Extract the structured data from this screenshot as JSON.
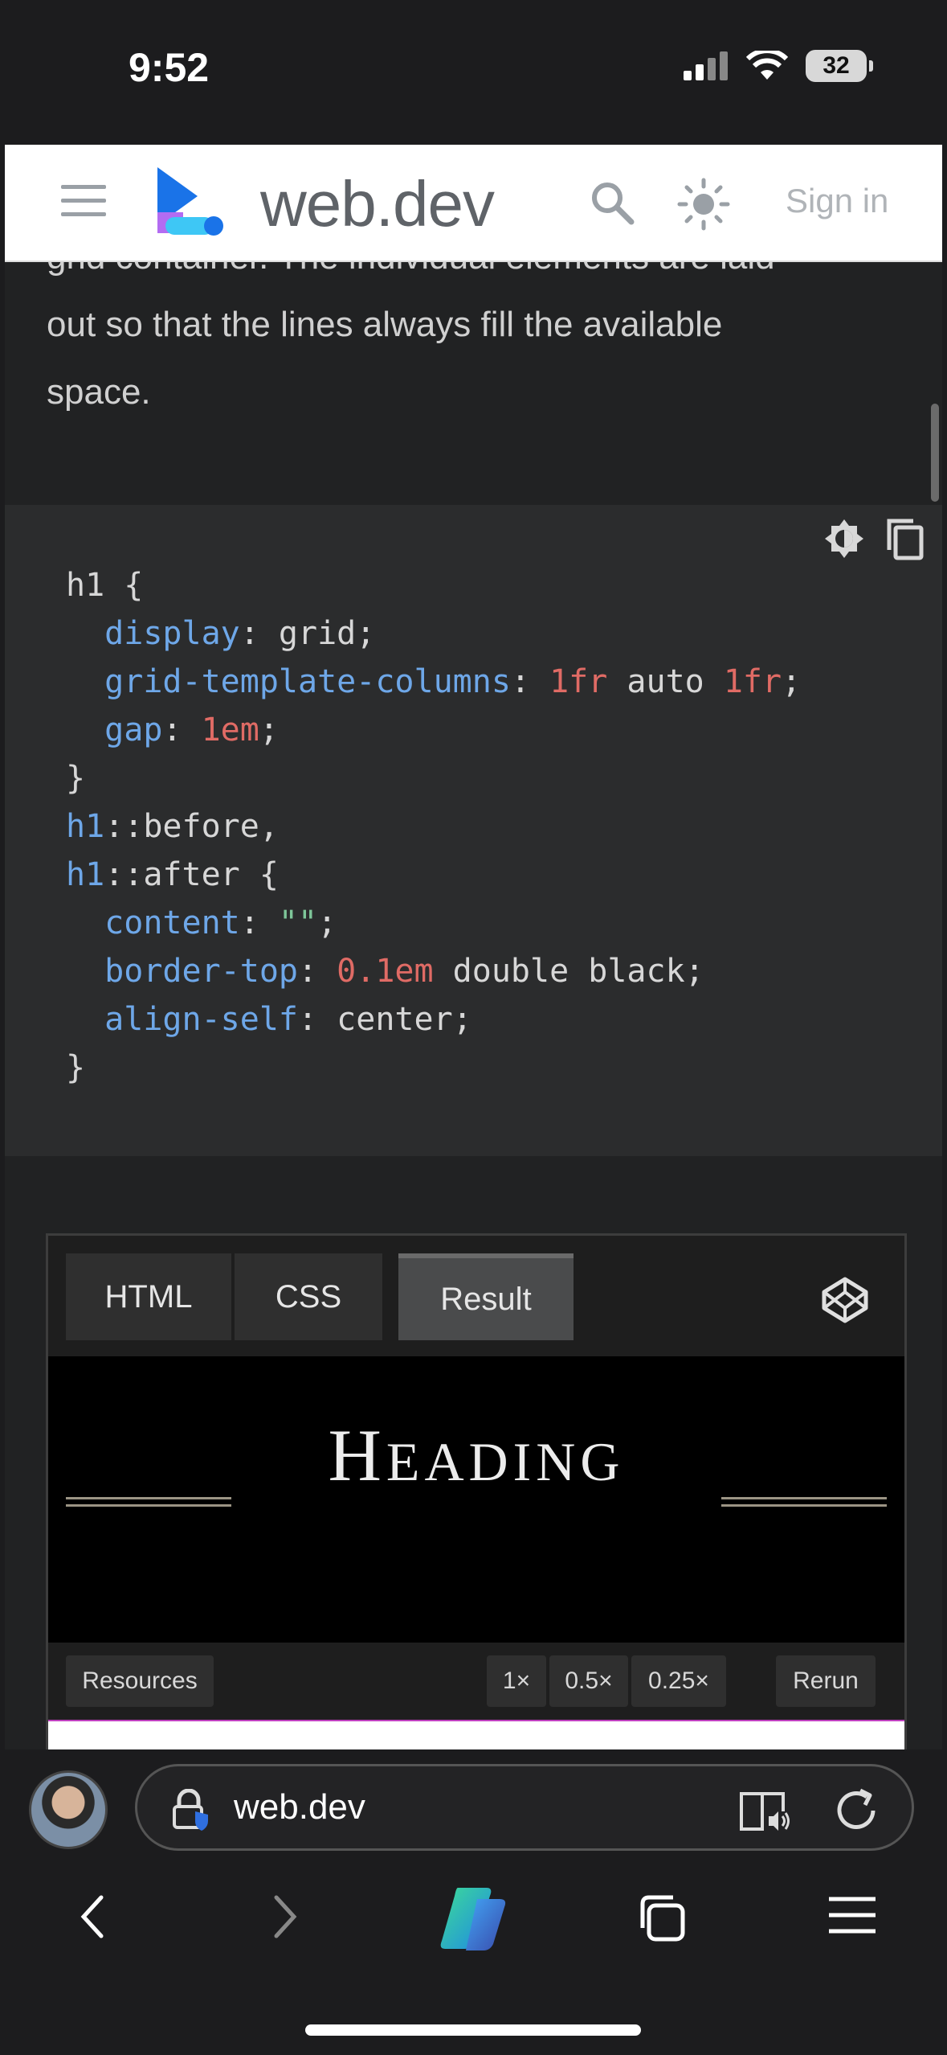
{
  "status": {
    "time": "9:52",
    "battery": "32"
  },
  "header": {
    "brand": "web.dev",
    "signin": "Sign in"
  },
  "article": {
    "paragraph_line1": "grid container. The individual elements are laid",
    "paragraph_line2": "out so that the lines always fill the available",
    "paragraph_line3": "space."
  },
  "code": {
    "lines": [
      "h1 {",
      "  display: grid;",
      "  grid-template-columns: 1fr auto 1fr;",
      "  gap: 1em;",
      "}",
      "h1::before,",
      "h1::after {",
      "  content: \"\";",
      "  border-top: 0.1em double black;",
      "  align-self: center;",
      "}"
    ]
  },
  "embed": {
    "tabs": [
      "HTML",
      "CSS",
      "Result"
    ],
    "active_tab": "Result",
    "heading_first": "H",
    "heading_rest": "EADING",
    "resources": "Resources",
    "zoom": [
      "1×",
      "0.5×",
      "0.25×"
    ],
    "rerun": "Rerun"
  },
  "browser": {
    "url": "web.dev"
  }
}
